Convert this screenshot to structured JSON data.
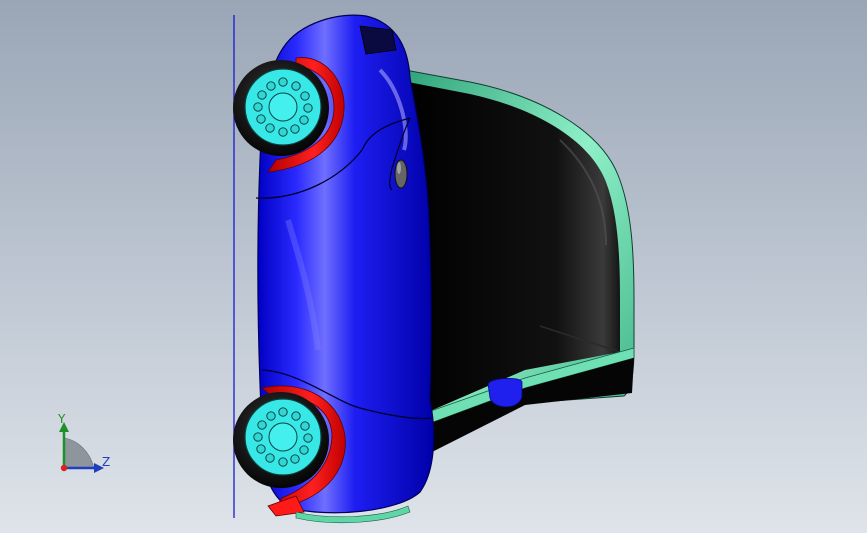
{
  "viewport": {
    "background_top": "#9aa6b6",
    "background_bottom": "#dfe4ea"
  },
  "model": {
    "body_color": "#1a1aee",
    "trim_color": "#5fd6a8",
    "fender_color": "#ff1a1a",
    "hub_color": "#38e8e6",
    "cavity_color": "#050505"
  },
  "triad": {
    "y_label": "Y",
    "z_label": "Z",
    "y_color": "#1f8f2a",
    "z_color": "#1f3fbf",
    "origin_color": "#e02020"
  }
}
